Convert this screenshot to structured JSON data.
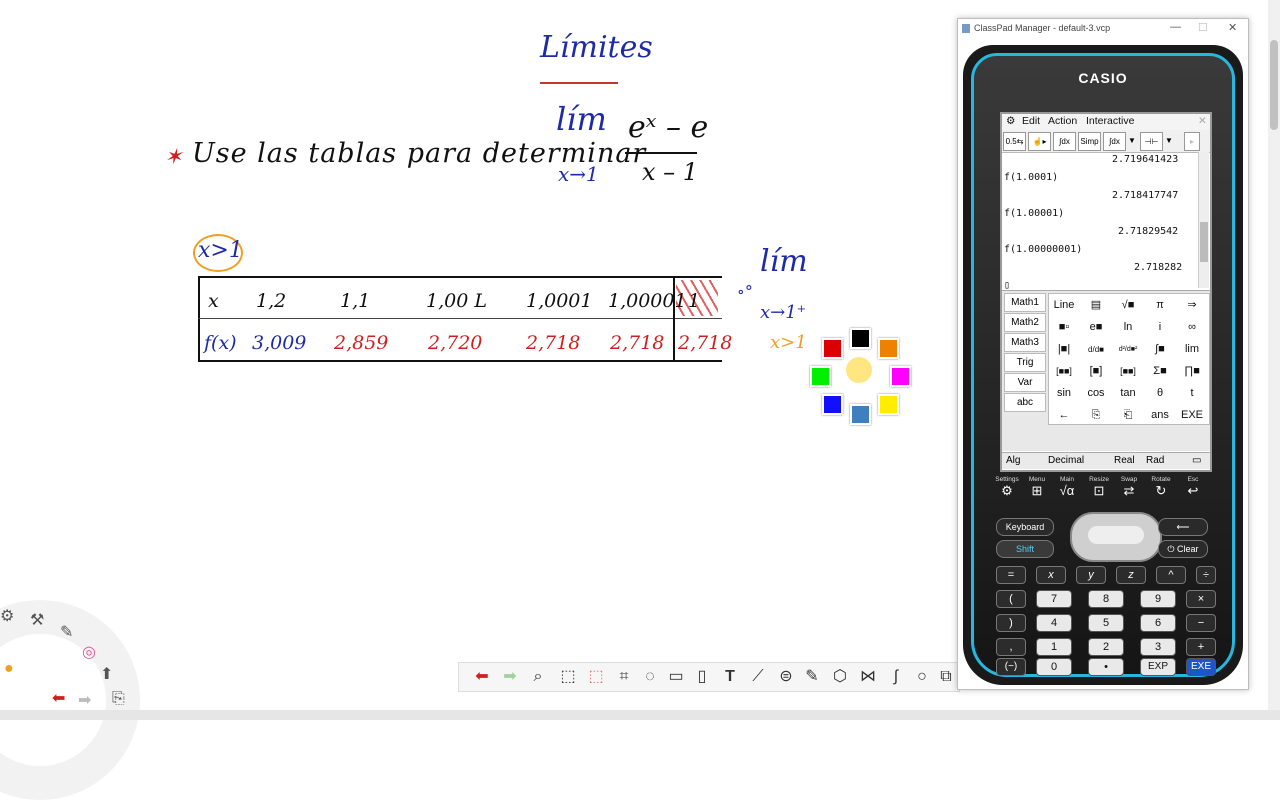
{
  "whiteboard": {
    "title": "Límites",
    "star": "✶",
    "instruction": "Use las tablas para determinar",
    "lim_word": "lím",
    "lim_sub": "x→1",
    "numerator": "eˣ – e",
    "denominator": "x – 1",
    "condition": "x>1",
    "table": {
      "row1": [
        "x",
        "1,2",
        "1,1",
        "1,00 L",
        "1,0001",
        "1,00001",
        "1"
      ],
      "row2": [
        "f(x)",
        "3,009",
        "2,859",
        "2,720",
        "2,718",
        "2,718",
        "2,718"
      ]
    },
    "side_lim": "lím",
    "side_sub": "x→1⁺",
    "side_cond": "x>1",
    "side_dot": "∘°"
  },
  "colors": {
    "ink_blue": "#1d2ba8",
    "ink_red": "#d01f1f",
    "highlight_orange": "#f0a020",
    "palette": [
      "#000000",
      "#f08000",
      "#ff00ff",
      "#ffee00",
      "#3f7fbf",
      "#1010ff",
      "#00ee00",
      "#dd0000"
    ],
    "calc_accent": "#26b7e0"
  },
  "toolbar": {
    "icons": [
      "undo-arrow-icon",
      "redo-arrow-icon",
      "search-icon",
      "select-icon",
      "lasso-icon",
      "crop-icon",
      "magic-select-icon",
      "shape-icon",
      "eraser-icon",
      "text-icon",
      "ruler-icon",
      "stamp-icon",
      "pen-icon",
      "shapes3d-icon",
      "measure-icon",
      "curve-icon",
      "circle-icon",
      "copy-icon"
    ],
    "glyphs": [
      "⬅",
      "➡",
      "⌕",
      "⬚",
      "⬚",
      "⌗",
      "◌",
      "▭",
      "▯",
      "T",
      "⟋",
      "⊜",
      "✎",
      "⬡",
      "⋈",
      "∫",
      "○",
      "⧉"
    ]
  },
  "left_tools": {
    "glyphs": [
      "⚙",
      "⚒",
      "✎",
      "◎",
      "⬆",
      "⬅",
      "➡",
      "⎘",
      "●"
    ]
  },
  "window": {
    "title": "ClassPad Manager - default-3.vcp",
    "min": "—",
    "max": "☐",
    "close": "✕"
  },
  "calculator": {
    "brand": "CASIO",
    "menu": [
      "⚙",
      "Edit",
      "Action",
      "Interactive",
      "✕"
    ],
    "icon_buttons": [
      "0.5⇆",
      "☝▸",
      "∫dx",
      "Simp",
      "∫dx",
      "▼",
      "⊣⊢",
      "▼",
      "▸"
    ],
    "history": [
      {
        "type": "result",
        "text": "2.719641423"
      },
      {
        "type": "input",
        "text": "f(1.0001)"
      },
      {
        "type": "result",
        "text": "2.718417747"
      },
      {
        "type": "input",
        "text": "f(1.00001)"
      },
      {
        "type": "result",
        "text": "2.71829542"
      },
      {
        "type": "input",
        "text": "f(1.00000001)"
      },
      {
        "type": "result",
        "text": "2.718282"
      },
      {
        "type": "input",
        "text": "▯"
      }
    ],
    "categories": [
      "Math1",
      "Math2",
      "Math3",
      "Trig",
      "Var",
      "abc"
    ],
    "keys": [
      [
        "Line",
        "▤",
        "√■",
        "π",
        "⇒"
      ],
      [
        "■▫",
        "e■",
        "ln",
        "i",
        "∞"
      ],
      [
        "|■|",
        "d/d■",
        "d²/d■²",
        "∫■",
        "lim"
      ],
      [
        "[■■]",
        "[■]",
        "[■■]",
        "Σ■",
        "∏■"
      ],
      [
        "sin",
        "cos",
        "tan",
        "θ",
        "t"
      ],
      [
        "←",
        "⎘",
        "⎗",
        "ans",
        "EXE"
      ]
    ],
    "status": [
      "Alg",
      "Decimal",
      "Real",
      "Rad",
      "▭"
    ],
    "softkeys": [
      {
        "label": "Settings",
        "icon": "⚙"
      },
      {
        "label": "Menu",
        "icon": "⊞"
      },
      {
        "label": "Main",
        "icon": "√α"
      },
      {
        "label": "Resize",
        "icon": "⊡"
      },
      {
        "label": "Swap",
        "icon": "⇄"
      },
      {
        "label": "Rotate",
        "icon": "↻"
      },
      {
        "label": "Esc",
        "icon": "↩"
      }
    ],
    "keyboard_btn": "Keyboard",
    "shift_btn": "Shift",
    "back_btn": "⟵",
    "clear_btn": "⏻ Clear",
    "keypad": [
      [
        "=",
        "x",
        "y",
        "z",
        "^",
        "÷"
      ],
      [
        "(",
        "7",
        "8",
        "9",
        "×"
      ],
      [
        ")",
        "4",
        "5",
        "6",
        "−"
      ],
      [
        ",",
        "1",
        "2",
        "3",
        "+"
      ],
      [
        "(−)",
        "0",
        "•",
        "EXP",
        "EXE"
      ]
    ]
  }
}
